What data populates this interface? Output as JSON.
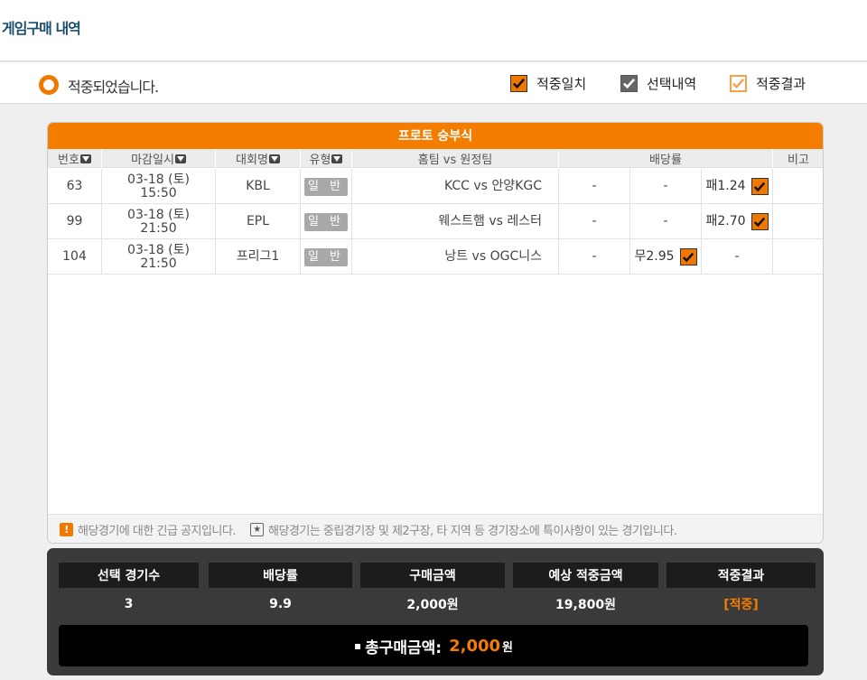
{
  "page": {
    "title": "게임구매 내역"
  },
  "status": {
    "message": "적중되었습니다.",
    "legend": [
      {
        "label": "적중일치",
        "icon": "checkbox-checked-orange-icon"
      },
      {
        "label": "선택내역",
        "icon": "checkbox-checked-gray-icon"
      },
      {
        "label": "적중결과",
        "icon": "checkbox-checked-outline-icon"
      }
    ]
  },
  "colors": {
    "accent": "#f47d00",
    "title": "#1b4f6e",
    "summary_bg": "#3a3a3a"
  },
  "table": {
    "title": "프로토 승부식",
    "headers": [
      "번호",
      "마감일시",
      "대회명",
      "유형",
      "홈팀 vs 원정팀",
      "배당률",
      "비고"
    ],
    "rows": [
      {
        "no": "63",
        "date": "03-18 (토)",
        "time": "15:50",
        "league": "KBL",
        "type": "일 반",
        "match": "KCC vs 안양KGC",
        "win": "-",
        "draw": "-",
        "lose": "패1.24",
        "note": ""
      },
      {
        "no": "99",
        "date": "03-18 (토)",
        "time": "21:50",
        "league": "EPL",
        "type": "일 반",
        "match": "웨스트햄 vs 레스터",
        "win": "-",
        "draw": "-",
        "lose": "패2.70",
        "note": ""
      },
      {
        "no": "104",
        "date": "03-18 (토)",
        "time": "21:50",
        "league": "프리그1",
        "type": "일 반",
        "match": "낭트 vs OGC니스",
        "win": "-",
        "draw": "무2.95",
        "lose": "-",
        "note": ""
      }
    ]
  },
  "notices": {
    "urgent": "해당경기에 대한 긴급 공지입니다.",
    "special": "해당경기는 중립경기장 및 제2구장, 타 지역 등 경기장소에 특이사항이 있는 경기입니다."
  },
  "summary": {
    "labels": [
      "선택 경기수",
      "배당률",
      "구매금액",
      "예상 적중금액",
      "적중결과"
    ],
    "values": [
      "3",
      "9.9",
      "2,000원",
      "19,800원",
      "[적중]"
    ],
    "total_label": "총구매금액:",
    "total_amount": "2,000",
    "total_unit": "원"
  }
}
